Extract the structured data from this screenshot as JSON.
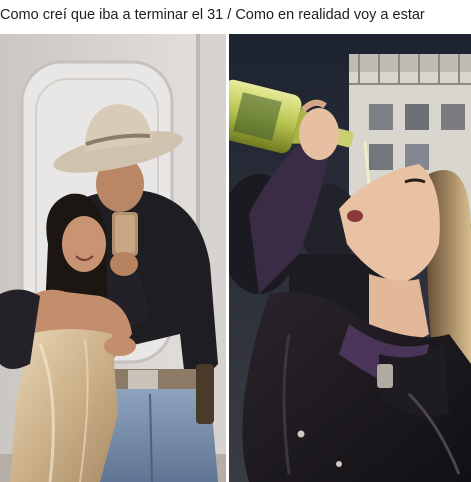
{
  "caption": "Como creí que iba a terminar el 31 / Como en realidad voy a estar",
  "photos": [
    {
      "name": "expectation-photo"
    },
    {
      "name": "reality-photo"
    }
  ]
}
